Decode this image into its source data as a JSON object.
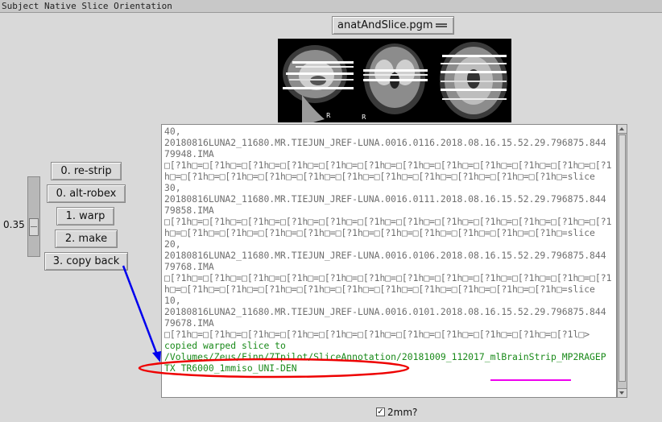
{
  "window": {
    "title": "Subject Native Slice Orientation"
  },
  "image_selector": {
    "selected": "anatAndSlice.pgm"
  },
  "thumbnails": [
    {
      "name": "sagittal",
      "marker": "R"
    },
    {
      "name": "coronal",
      "marker": "R"
    },
    {
      "name": "axial",
      "marker": ""
    }
  ],
  "scale": {
    "value": "0.35"
  },
  "buttons": {
    "restrip": "0. re-strip",
    "altrobex": "0. alt-robex",
    "warp": "1. warp",
    "make": "2. make",
    "copyback": "3. copy back"
  },
  "log": {
    "lines": [
      "40,",
      "20180816LUNA2_11680.MR.TIEJUN_JREF-LUNA.0016.0116.2018.08.16.15.52.29.796875.844",
      "79948.IMA",
      "□[?1h□=□[?1h□=□[?1h□=□[?1h□=□[?1h□=□[?1h□=□[?1h□=□[?1h□=□[?1h□=□[?1h□=□[?1h□=□[?1",
      "h□=□[?1h□=□[?1h□=□[?1h□=□[?1h□=□[?1h□=□[?1h□=□[?1h□=□[?1h□=□[?1h□=□[?1h□=slice",
      "30,",
      "20180816LUNA2_11680.MR.TIEJUN_JREF-LUNA.0016.0111.2018.08.16.15.52.29.796875.844",
      "79858.IMA",
      "□[?1h□=□[?1h□=□[?1h□=□[?1h□=□[?1h□=□[?1h□=□[?1h□=□[?1h□=□[?1h□=□[?1h□=□[?1h□=□[?1",
      "h□=□[?1h□=□[?1h□=□[?1h□=□[?1h□=□[?1h□=□[?1h□=□[?1h□=□[?1h□=□[?1h□=□[?1h□=slice",
      "20,",
      "20180816LUNA2_11680.MR.TIEJUN_JREF-LUNA.0016.0106.2018.08.16.15.52.29.796875.844",
      "79768.IMA",
      "□[?1h□=□[?1h□=□[?1h□=□[?1h□=□[?1h□=□[?1h□=□[?1h□=□[?1h□=□[?1h□=□[?1h□=□[?1h□=□[?1",
      "h□=□[?1h□=□[?1h□=□[?1h□=□[?1h□=□[?1h□=□[?1h□=□[?1h□=□[?1h□=□[?1h□=□[?1h□=slice",
      "10,",
      "20180816LUNA2_11680.MR.TIEJUN_JREF-LUNA.0016.0101.2018.08.16.15.52.29.796875.844",
      "79678.IMA",
      "□[?1h□=□[?1h□=□[?1h□=□[?1h□=□[?1h□=□[?1h□=□[?1h□=□[?1h□=□[?1h□=□[?1h□=□[?1l□>"
    ],
    "green_lines": [
      "copied warped slice to",
      "/Volumes/Zeus/Finn/7Tpilot/SliceAnnotation/20181009_112017_mlBrainStrip_MP2RAGEP",
      "TX_TR6000_1mmiso_UNI-DEN"
    ]
  },
  "checkbox": {
    "label": "2mm?",
    "checked": true
  },
  "colors": {
    "annotation_arrow": "#0000ee",
    "annotation_ellipse": "#ee0000",
    "annotation_underline": "#ee00ee",
    "log_text": "#6e6e6e",
    "log_green": "#1a8a1a"
  }
}
